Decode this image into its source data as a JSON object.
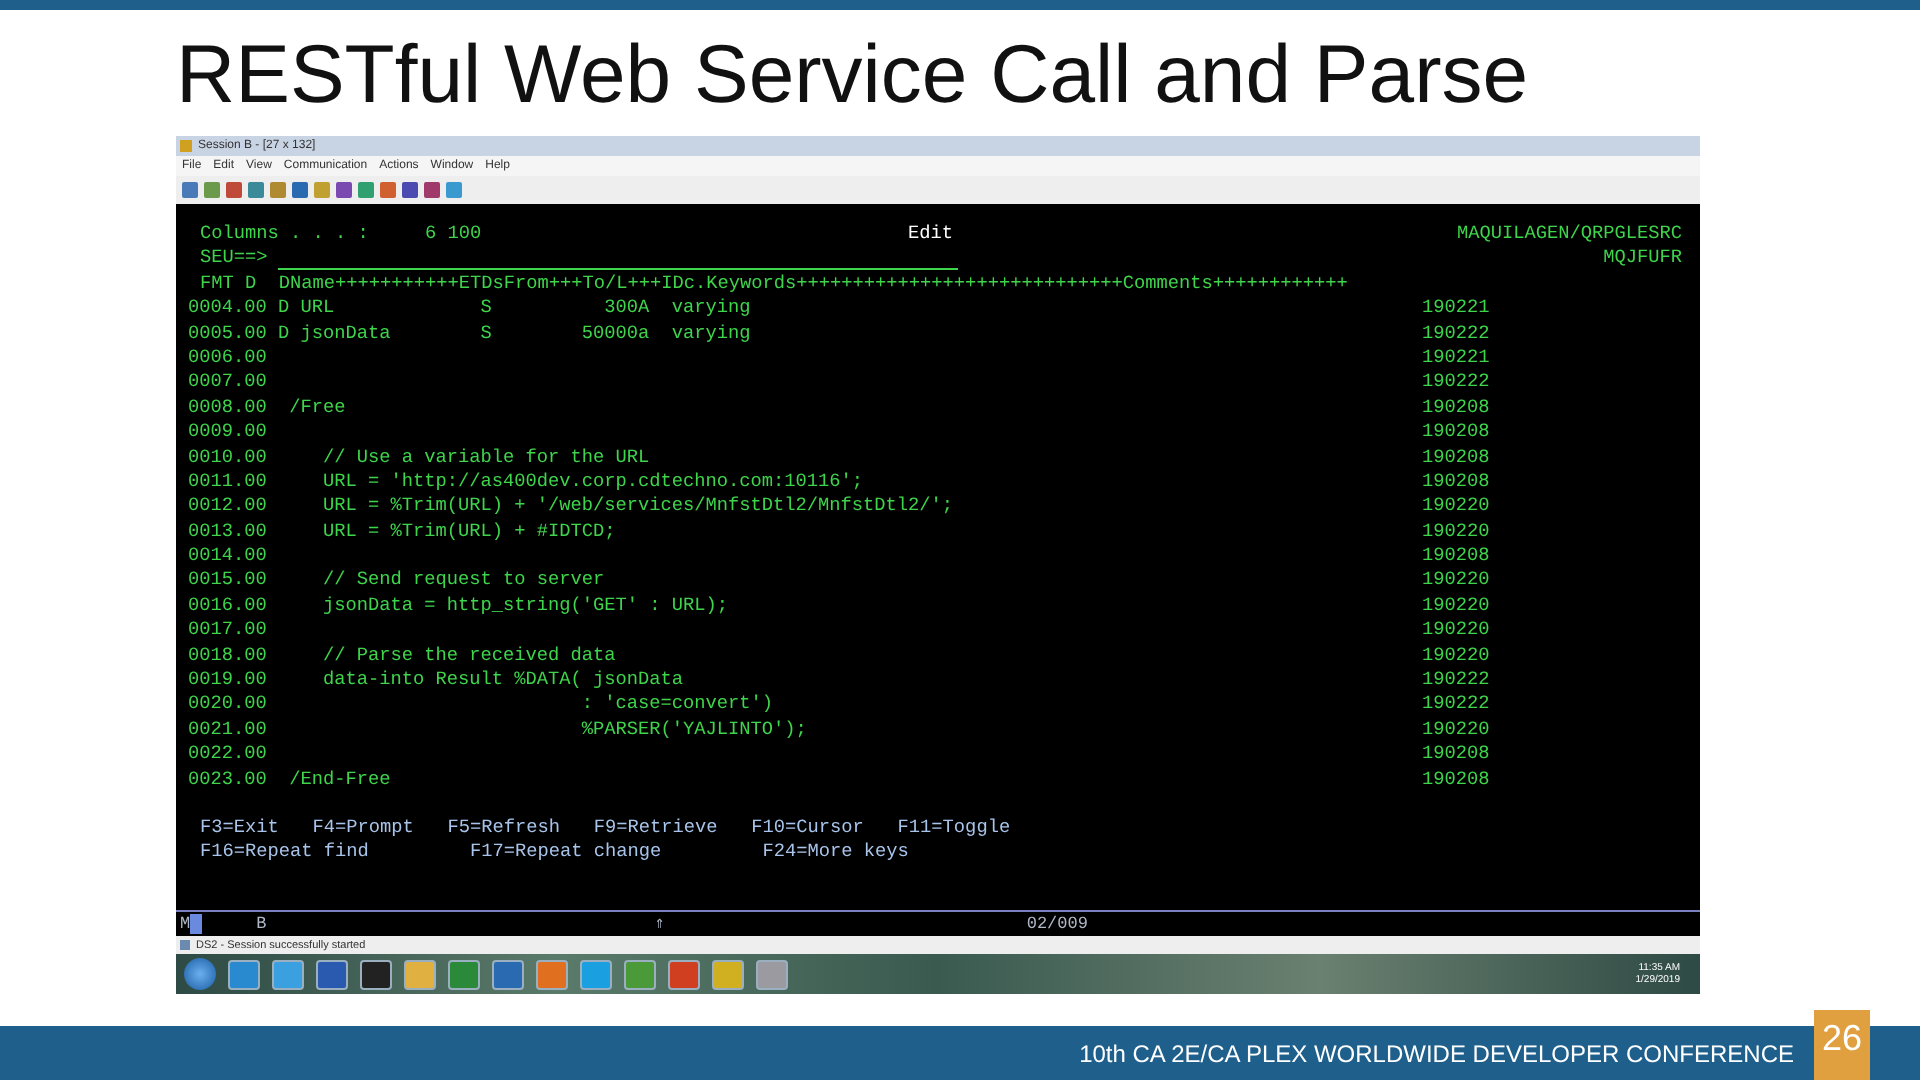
{
  "slide": {
    "title": "RESTful Web Service Call and Parse"
  },
  "window": {
    "title": "Session B - [27 x 132]",
    "menu": [
      "File",
      "Edit",
      "View",
      "Communication",
      "Actions",
      "Window",
      "Help"
    ]
  },
  "terminal": {
    "columns": "Columns . . . :     6 100",
    "mode": "Edit",
    "library": "MAQUILAGEN/QRPGLESRC",
    "prompt": "SEU==>",
    "member": "MQJFUFR",
    "format": "FMT D  DName+++++++++++ETDsFrom+++To/L+++IDc.Keywords+++++++++++++++++++++++++++++Comments++++++++++++",
    "lines": [
      {
        "seq": "0004.00",
        "code": "D URL             S          300A  varying",
        "date": "190221"
      },
      {
        "seq": "0005.00",
        "code": "D jsonData        S        50000a  varying",
        "date": "190222"
      },
      {
        "seq": "0006.00",
        "date": "190221"
      },
      {
        "seq": "0007.00",
        "date": "190222"
      },
      {
        "seq": "0008.00",
        "code": " /Free",
        "date": "190208"
      },
      {
        "seq": "0009.00",
        "date": "190208"
      },
      {
        "seq": "0010.00",
        "code": "    // Use a variable for the URL",
        "date": "190208"
      },
      {
        "seq": "0011.00",
        "code": "    URL = 'http://as400dev.corp.cdtechno.com:10116';",
        "date": "190208"
      },
      {
        "seq": "0012.00",
        "code": "    URL = %Trim(URL) + '/web/services/MnfstDtl2/MnfstDtl2/';",
        "date": "190220"
      },
      {
        "seq": "0013.00",
        "code": "    URL = %Trim(URL) + #IDTCD;",
        "date": "190220"
      },
      {
        "seq": "0014.00",
        "date": "190208"
      },
      {
        "seq": "0015.00",
        "code": "    // Send request to server",
        "date": "190220"
      },
      {
        "seq": "0016.00",
        "code": "    jsonData = http_string('GET' : URL);",
        "date": "190220"
      },
      {
        "seq": "0017.00",
        "date": "190220"
      },
      {
        "seq": "0018.00",
        "code": "    // Parse the received data",
        "date": "190220"
      },
      {
        "seq": "0019.00",
        "code": "    data-into Result %DATA( jsonData",
        "date": "190222"
      },
      {
        "seq": "0020.00",
        "code": "                           : 'case=convert')",
        "date": "190222"
      },
      {
        "seq": "0021.00",
        "code": "                           %PARSER('YAJLINTO');",
        "date": "190220"
      },
      {
        "seq": "0022.00",
        "date": "190208"
      },
      {
        "seq": "0023.00",
        "code": " /End-Free",
        "date": "190208"
      }
    ],
    "function_keys": [
      "F3=Exit   F4=Prompt   F5=Refresh   F9=Retrieve   F10=Cursor   F11=Toggle",
      "F16=Repeat find         F17=Repeat change         F24=More keys"
    ],
    "status": {
      "indicator": "M",
      "field": "B",
      "shift": "⇑",
      "position": "02/009"
    }
  },
  "message": "DS2 - Session successfully started",
  "taskbar": {
    "time": "11:35 AM",
    "date": "1/29/2019"
  },
  "footer": {
    "conference": "10th CA 2E/CA PLEX WORLDWIDE DEVELOPER CONFERENCE",
    "page": "26"
  }
}
